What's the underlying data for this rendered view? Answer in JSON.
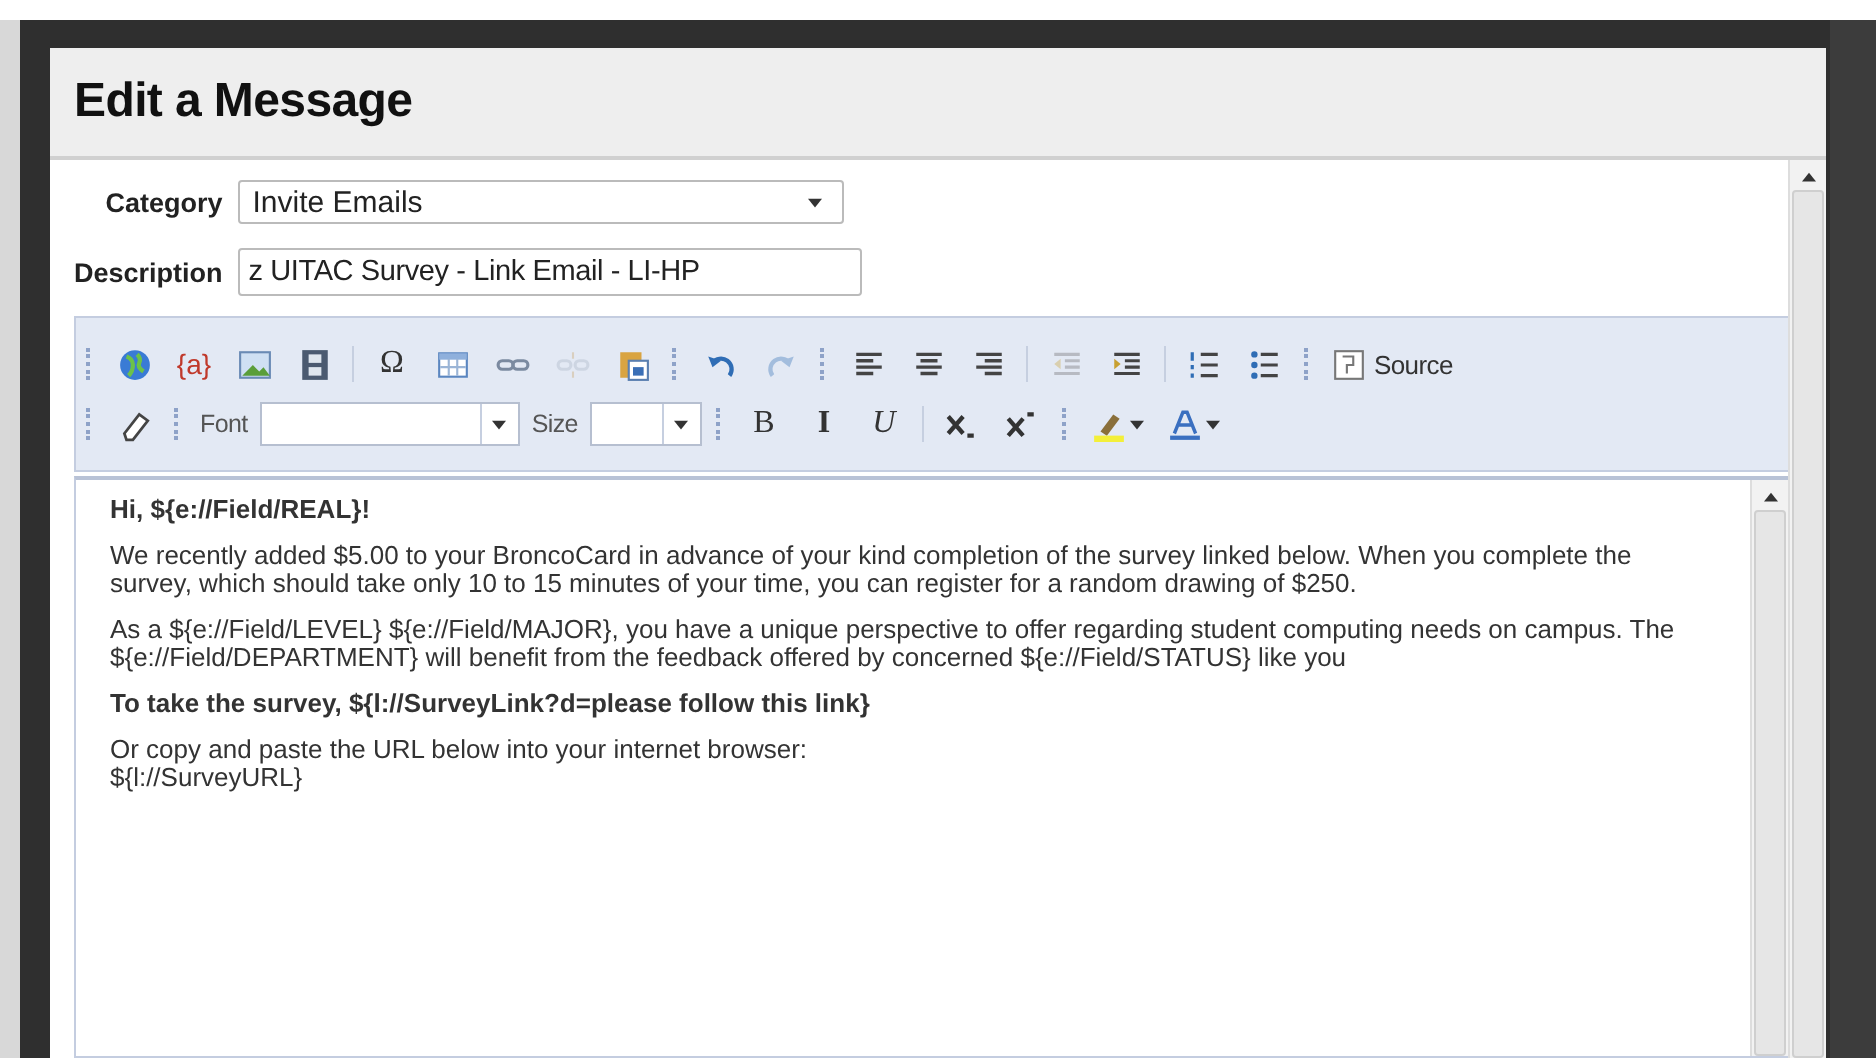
{
  "dialog": {
    "title": "Edit a Message"
  },
  "category": {
    "label": "Category",
    "value": "Invite Emails"
  },
  "description": {
    "label": "Description",
    "value": "z UITAC Survey - Link Email - LI-HP"
  },
  "toolbar": {
    "rows": [
      {
        "groups": [
          {
            "items": [
              {
                "kind": "icon",
                "disabled": false
              },
              {
                "kind": "glyph",
                "text": "{a}",
                "disabled": false
              },
              {
                "kind": "icon",
                "disabled": false
              },
              {
                "kind": "icon",
                "disabled": false
              }
            ]
          },
          {
            "items": [
              {
                "kind": "glyph",
                "text": "Ω",
                "disabled": false
              },
              {
                "kind": "icon",
                "disabled": false
              },
              {
                "kind": "icon",
                "disabled": false
              },
              {
                "kind": "icon",
                "disabled": true
              },
              {
                "kind": "icon",
                "disabled": false
              }
            ]
          },
          {
            "items": [
              {
                "kind": "icon",
                "disabled": false
              },
              {
                "kind": "icon",
                "disabled": true
              }
            ]
          },
          {
            "items": [
              {
                "kind": "icon",
                "disabled": false
              },
              {
                "kind": "icon",
                "disabled": false
              },
              {
                "kind": "icon",
                "disabled": false
              }
            ]
          },
          {
            "items": [
              {
                "kind": "icon",
                "disabled": true
              },
              {
                "kind": "icon",
                "disabled": false
              }
            ]
          },
          {
            "items": [
              {
                "kind": "icon",
                "disabled": false
              },
              {
                "kind": "icon",
                "disabled": false
              }
            ]
          },
          {
            "items": [
              {
                "kind": "button",
                "text": "Source"
              }
            ]
          }
        ]
      },
      {
        "groups": [
          {
            "items": [
              {
                "kind": "icon",
                "disabled": false
              }
            ]
          },
          {
            "items": [
              {
                "kind": "label",
                "text": "Font"
              },
              {
                "kind": "combo"
              },
              {
                "kind": "label",
                "text": "Size"
              },
              {
                "kind": "combo"
              }
            ]
          },
          {
            "items": [
              {
                "kind": "glyph",
                "text": "B",
                "disabled": false
              },
              {
                "kind": "glyph",
                "text": "I",
                "disabled": false
              },
              {
                "kind": "glyph",
                "text": "U",
                "disabled": false
              }
            ]
          },
          {
            "items": [
              {
                "kind": "icon",
                "disabled": false
              },
              {
                "kind": "icon",
                "disabled": false
              }
            ]
          },
          {
            "items": [
              {
                "kind": "icon",
                "disabled": false
              },
              {
                "kind": "icon",
                "disabled": false
              }
            ]
          }
        ]
      }
    ]
  },
  "body": {
    "paragraphs": [
      {
        "bold": true,
        "lines": [
          "Hi, ${e://Field/REAL}!"
        ]
      },
      {
        "bold": false,
        "lines": [
          "We recently added $5.00 to your BroncoCard in advance of your kind completion of the survey linked below. When you complete the survey, which should take only 10 to 15 minutes of your time, you can register for a random drawing of $250."
        ]
      },
      {
        "bold": false,
        "lines": [
          "As a ${e://Field/LEVEL} ${e://Field/MAJOR}, you have a unique perspective to offer regarding student computing needs on campus. The ${e://Field/DEPARTMENT} will benefit from the feedback offered by concerned ${e://Field/STATUS} like you"
        ]
      },
      {
        "bold": true,
        "lines": [
          "To take the survey, ${l://SurveyLink?d=please follow this link}"
        ]
      },
      {
        "bold": false,
        "lines": [
          "Or copy and paste the URL below into your internet browser:",
          "${l://SurveyURL}"
        ]
      }
    ]
  }
}
